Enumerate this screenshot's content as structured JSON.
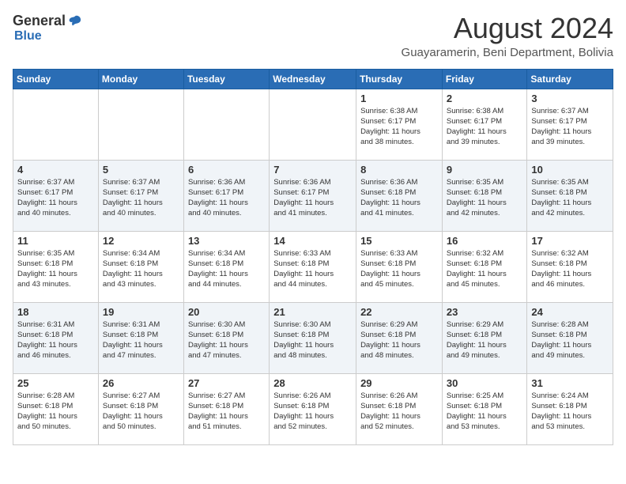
{
  "header": {
    "logo_general": "General",
    "logo_blue": "Blue",
    "month_title": "August 2024",
    "location": "Guayaramerin, Beni Department, Bolivia"
  },
  "days_of_week": [
    "Sunday",
    "Monday",
    "Tuesday",
    "Wednesday",
    "Thursday",
    "Friday",
    "Saturday"
  ],
  "weeks": [
    [
      {
        "day": "",
        "info": ""
      },
      {
        "day": "",
        "info": ""
      },
      {
        "day": "",
        "info": ""
      },
      {
        "day": "",
        "info": ""
      },
      {
        "day": "1",
        "info": "Sunrise: 6:38 AM\nSunset: 6:17 PM\nDaylight: 11 hours\nand 38 minutes."
      },
      {
        "day": "2",
        "info": "Sunrise: 6:38 AM\nSunset: 6:17 PM\nDaylight: 11 hours\nand 39 minutes."
      },
      {
        "day": "3",
        "info": "Sunrise: 6:37 AM\nSunset: 6:17 PM\nDaylight: 11 hours\nand 39 minutes."
      }
    ],
    [
      {
        "day": "4",
        "info": "Sunrise: 6:37 AM\nSunset: 6:17 PM\nDaylight: 11 hours\nand 40 minutes."
      },
      {
        "day": "5",
        "info": "Sunrise: 6:37 AM\nSunset: 6:17 PM\nDaylight: 11 hours\nand 40 minutes."
      },
      {
        "day": "6",
        "info": "Sunrise: 6:36 AM\nSunset: 6:17 PM\nDaylight: 11 hours\nand 40 minutes."
      },
      {
        "day": "7",
        "info": "Sunrise: 6:36 AM\nSunset: 6:17 PM\nDaylight: 11 hours\nand 41 minutes."
      },
      {
        "day": "8",
        "info": "Sunrise: 6:36 AM\nSunset: 6:18 PM\nDaylight: 11 hours\nand 41 minutes."
      },
      {
        "day": "9",
        "info": "Sunrise: 6:35 AM\nSunset: 6:18 PM\nDaylight: 11 hours\nand 42 minutes."
      },
      {
        "day": "10",
        "info": "Sunrise: 6:35 AM\nSunset: 6:18 PM\nDaylight: 11 hours\nand 42 minutes."
      }
    ],
    [
      {
        "day": "11",
        "info": "Sunrise: 6:35 AM\nSunset: 6:18 PM\nDaylight: 11 hours\nand 43 minutes."
      },
      {
        "day": "12",
        "info": "Sunrise: 6:34 AM\nSunset: 6:18 PM\nDaylight: 11 hours\nand 43 minutes."
      },
      {
        "day": "13",
        "info": "Sunrise: 6:34 AM\nSunset: 6:18 PM\nDaylight: 11 hours\nand 44 minutes."
      },
      {
        "day": "14",
        "info": "Sunrise: 6:33 AM\nSunset: 6:18 PM\nDaylight: 11 hours\nand 44 minutes."
      },
      {
        "day": "15",
        "info": "Sunrise: 6:33 AM\nSunset: 6:18 PM\nDaylight: 11 hours\nand 45 minutes."
      },
      {
        "day": "16",
        "info": "Sunrise: 6:32 AM\nSunset: 6:18 PM\nDaylight: 11 hours\nand 45 minutes."
      },
      {
        "day": "17",
        "info": "Sunrise: 6:32 AM\nSunset: 6:18 PM\nDaylight: 11 hours\nand 46 minutes."
      }
    ],
    [
      {
        "day": "18",
        "info": "Sunrise: 6:31 AM\nSunset: 6:18 PM\nDaylight: 11 hours\nand 46 minutes."
      },
      {
        "day": "19",
        "info": "Sunrise: 6:31 AM\nSunset: 6:18 PM\nDaylight: 11 hours\nand 47 minutes."
      },
      {
        "day": "20",
        "info": "Sunrise: 6:30 AM\nSunset: 6:18 PM\nDaylight: 11 hours\nand 47 minutes."
      },
      {
        "day": "21",
        "info": "Sunrise: 6:30 AM\nSunset: 6:18 PM\nDaylight: 11 hours\nand 48 minutes."
      },
      {
        "day": "22",
        "info": "Sunrise: 6:29 AM\nSunset: 6:18 PM\nDaylight: 11 hours\nand 48 minutes."
      },
      {
        "day": "23",
        "info": "Sunrise: 6:29 AM\nSunset: 6:18 PM\nDaylight: 11 hours\nand 49 minutes."
      },
      {
        "day": "24",
        "info": "Sunrise: 6:28 AM\nSunset: 6:18 PM\nDaylight: 11 hours\nand 49 minutes."
      }
    ],
    [
      {
        "day": "25",
        "info": "Sunrise: 6:28 AM\nSunset: 6:18 PM\nDaylight: 11 hours\nand 50 minutes."
      },
      {
        "day": "26",
        "info": "Sunrise: 6:27 AM\nSunset: 6:18 PM\nDaylight: 11 hours\nand 50 minutes."
      },
      {
        "day": "27",
        "info": "Sunrise: 6:27 AM\nSunset: 6:18 PM\nDaylight: 11 hours\nand 51 minutes."
      },
      {
        "day": "28",
        "info": "Sunrise: 6:26 AM\nSunset: 6:18 PM\nDaylight: 11 hours\nand 52 minutes."
      },
      {
        "day": "29",
        "info": "Sunrise: 6:26 AM\nSunset: 6:18 PM\nDaylight: 11 hours\nand 52 minutes."
      },
      {
        "day": "30",
        "info": "Sunrise: 6:25 AM\nSunset: 6:18 PM\nDaylight: 11 hours\nand 53 minutes."
      },
      {
        "day": "31",
        "info": "Sunrise: 6:24 AM\nSunset: 6:18 PM\nDaylight: 11 hours\nand 53 minutes."
      }
    ]
  ]
}
